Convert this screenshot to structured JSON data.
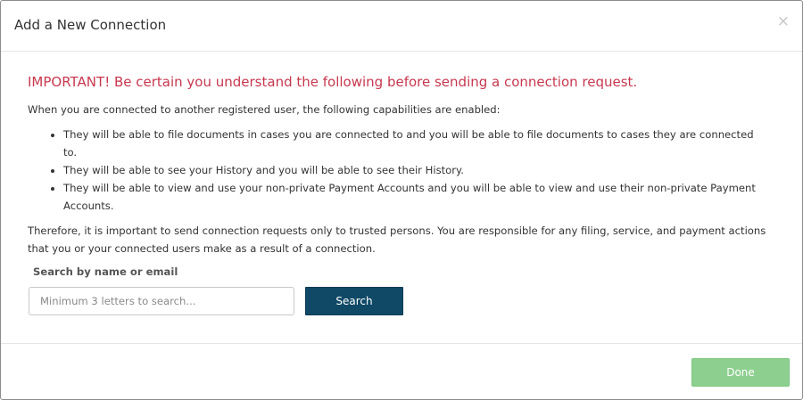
{
  "dialog": {
    "title": "Add a New Connection",
    "close_glyph": "×"
  },
  "body": {
    "important": "IMPORTANT! Be certain you understand the following before sending a connection request.",
    "intro": "When you are connected to another registered user, the following capabilities are enabled:",
    "capabilities": [
      "They will be able to file documents in cases you are connected to and you will be able to file documents to cases they are connected to.",
      "They will be able to see your History and you will be able to see their History.",
      "They will be able to view and use your non-private Payment Accounts and you will be able to view and use their non-private Payment Accounts."
    ],
    "therefore": "Therefore, it is important to send connection requests only to trusted persons. You are responsible for any filing, service, and payment actions that you or your connected users make as a result of a connection."
  },
  "search": {
    "label": "Search by name or email",
    "placeholder": "Minimum 3 letters to search...",
    "value": "",
    "button_label": "Search"
  },
  "footer": {
    "done_label": "Done"
  },
  "colors": {
    "important_text": "#c7384f",
    "search_button": "#0f4966",
    "done_button": "#8dcf8f"
  }
}
